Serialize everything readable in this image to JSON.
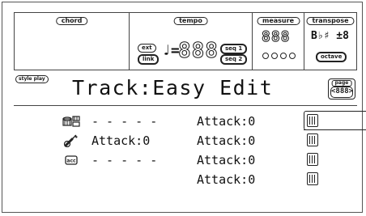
{
  "header": {
    "chord": {
      "label": "chord"
    },
    "tempo": {
      "label": "tempo",
      "ext_label": "ext",
      "link_label": "link",
      "note_symbol": "♩=",
      "value": "888",
      "seq1_label": "seq 1",
      "seq2_label": "seq 2"
    },
    "measure": {
      "label": "measure",
      "value": "888"
    },
    "transpose": {
      "label": "transpose",
      "value": "B♭♯ ±8",
      "octave_label": "octave"
    }
  },
  "mode_badge": "style play",
  "title": "Track:Easy Edit",
  "page": {
    "label": "page",
    "value": "<888>"
  },
  "tracks": [
    {
      "icon": "drum-icon",
      "left": "- - - - -",
      "right": "Attack:0"
    },
    {
      "icon": "guitar-icon",
      "left": "Attack:0",
      "right": "Attack:0"
    },
    {
      "icon": "acc-icon",
      "icon_text": "acc",
      "left": "- - - - -",
      "right": "Attack:0"
    },
    {
      "icon": "",
      "left": "",
      "right": "Attack:0"
    }
  ]
}
